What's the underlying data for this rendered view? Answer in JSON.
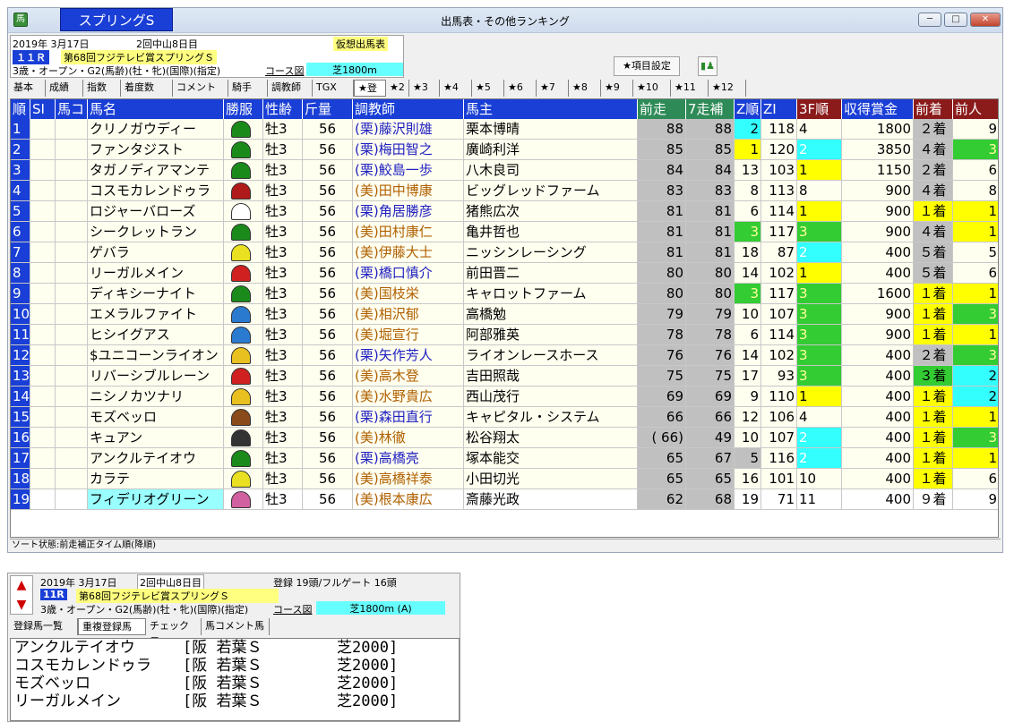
{
  "window": {
    "title": "出馬表・その他ランキング",
    "race_tab": "スプリングS",
    "controls": {
      "minimize": "─",
      "maximize": "□",
      "close": "✕"
    }
  },
  "race": {
    "date": "2019年 3月17日",
    "meeting": "2回中山8日目",
    "mode": "仮想出馬表",
    "race_no": "１１Ｒ",
    "race_name": "第68回フジテレビ賞スプリングＳ",
    "conditions": "3歳・オープン・G2(馬齢)(牡・牝)(国際)(指定)",
    "course_label": "コース図",
    "surface": "芝1800m"
  },
  "toolbar": {
    "item_settings": "★項目設定"
  },
  "tabs": [
    "基本",
    "成績",
    "指数",
    "着度数",
    "コメント",
    "騎手",
    "調教師",
    "TGX",
    "★登録",
    "★2",
    "★3",
    "★4",
    "★5",
    "★6",
    "★7",
    "★8",
    "★9",
    "★10",
    "★11",
    "★12"
  ],
  "active_tab": "★登録",
  "columns": [
    "順",
    "SI",
    "馬コ",
    "馬名",
    "勝服",
    "性齢",
    "斤量",
    "調教師",
    "馬主",
    "前走",
    "7走補",
    "Z順",
    "ZI",
    "3F順",
    "収得賞金",
    "前着",
    "前人"
  ],
  "colors": {
    "header_blue": "#1a3fd6",
    "header_green": "#2e8b57",
    "header_darkred": "#8b1a1a",
    "yellow": "#ffff00",
    "cyan": "#33ffff",
    "green": "#33cc33",
    "gray": "#c0c0c0",
    "miho": "#b06000",
    "ritto": "#2020c0"
  },
  "rows": [
    {
      "no": "1",
      "name": "クリノガウディー",
      "sex": "牡3",
      "wt": "56",
      "trainer": "(栗)藤沢則雄",
      "tloc": "栗",
      "owner": "栗本博晴",
      "prev": "88",
      "seven": "88",
      "zr": "2",
      "zrc": "cyan",
      "zi": "118",
      "f3": "4",
      "f3c": "",
      "prize": "1800",
      "pc": "２着",
      "pcc": "gray",
      "pp": "9",
      "ppc": ""
    },
    {
      "no": "2",
      "name": "ファンタジスト",
      "sex": "牡3",
      "wt": "56",
      "trainer": "(栗)梅田智之",
      "tloc": "栗",
      "owner": "廣崎利洋",
      "prev": "85",
      "seven": "85",
      "zr": "1",
      "zrc": "yellow",
      "zi": "120",
      "f3": "2",
      "f3c": "cyan",
      "prize": "3850",
      "pc": "４着",
      "pcc": "gray",
      "pp": "3",
      "ppc": "green"
    },
    {
      "no": "3",
      "name": "タガノディアマンテ",
      "sex": "牡3",
      "wt": "56",
      "trainer": "(栗)鮫島一歩",
      "tloc": "栗",
      "owner": "八木良司",
      "prev": "84",
      "seven": "84",
      "zr": "13",
      "zrc": "",
      "zi": "103",
      "f3": "1",
      "f3c": "yellow",
      "prize": "1150",
      "pc": "２着",
      "pcc": "gray",
      "pp": "6",
      "ppc": ""
    },
    {
      "no": "4",
      "name": "コスモカレンドゥラ",
      "sex": "牡3",
      "wt": "56",
      "trainer": "(美)田中博康",
      "tloc": "美",
      "owner": "ビッグレッドファーム",
      "prev": "83",
      "seven": "83",
      "zr": "8",
      "zrc": "",
      "zi": "113",
      "f3": "8",
      "f3c": "",
      "prize": "900",
      "pc": "４着",
      "pcc": "gray",
      "pp": "8",
      "ppc": ""
    },
    {
      "no": "5",
      "name": "ロジャーバローズ",
      "sex": "牡3",
      "wt": "56",
      "trainer": "(栗)角居勝彦",
      "tloc": "栗",
      "owner": "猪熊広次",
      "prev": "81",
      "seven": "81",
      "zr": "6",
      "zrc": "",
      "zi": "114",
      "f3": "1",
      "f3c": "yellow",
      "prize": "900",
      "pc": "１着",
      "pcc": "yellow",
      "pp": "1",
      "ppc": "yellow"
    },
    {
      "no": "6",
      "name": "シークレットラン",
      "sex": "牡3",
      "wt": "56",
      "trainer": "(美)田村康仁",
      "tloc": "美",
      "owner": "亀井哲也",
      "prev": "81",
      "seven": "81",
      "zr": "3",
      "zrc": "green",
      "zi": "117",
      "f3": "3",
      "f3c": "green",
      "prize": "900",
      "pc": "４着",
      "pcc": "gray",
      "pp": "1",
      "ppc": "yellow"
    },
    {
      "no": "7",
      "name": "ゲバラ",
      "sex": "牡3",
      "wt": "56",
      "trainer": "(美)伊藤大士",
      "tloc": "美",
      "owner": "ニッシンレーシング",
      "prev": "81",
      "seven": "81",
      "zr": "18",
      "zrc": "",
      "zi": "87",
      "f3": "2",
      "f3c": "cyan",
      "prize": "400",
      "pc": "５着",
      "pcc": "gray",
      "pp": "5",
      "ppc": ""
    },
    {
      "no": "8",
      "name": "リーガルメイン",
      "sex": "牡3",
      "wt": "56",
      "trainer": "(栗)橋口慎介",
      "tloc": "栗",
      "owner": "前田晋二",
      "prev": "80",
      "seven": "80",
      "zr": "14",
      "zrc": "",
      "zi": "102",
      "f3": "1",
      "f3c": "yellow",
      "prize": "400",
      "pc": "５着",
      "pcc": "gray",
      "pp": "6",
      "ppc": ""
    },
    {
      "no": "9",
      "name": "ディキシーナイト",
      "sex": "牡3",
      "wt": "56",
      "trainer": "(美)国枝栄",
      "tloc": "美",
      "owner": "キャロットファーム",
      "prev": "80",
      "seven": "80",
      "zr": "3",
      "zrc": "green",
      "zi": "117",
      "f3": "3",
      "f3c": "green",
      "prize": "1600",
      "pc": "１着",
      "pcc": "yellow",
      "pp": "1",
      "ppc": "yellow"
    },
    {
      "no": "10",
      "name": "エメラルファイト",
      "sex": "牡3",
      "wt": "56",
      "trainer": "(美)相沢郁",
      "tloc": "美",
      "owner": "高橋勉",
      "prev": "79",
      "seven": "79",
      "zr": "10",
      "zrc": "",
      "zi": "107",
      "f3": "3",
      "f3c": "green",
      "prize": "900",
      "pc": "１着",
      "pcc": "yellow",
      "pp": "3",
      "ppc": "green"
    },
    {
      "no": "11",
      "name": "ヒシイグアス",
      "sex": "牡3",
      "wt": "56",
      "trainer": "(美)堀宣行",
      "tloc": "美",
      "owner": "阿部雅英",
      "prev": "78",
      "seven": "78",
      "zr": "6",
      "zrc": "",
      "zi": "114",
      "f3": "3",
      "f3c": "green",
      "prize": "900",
      "pc": "１着",
      "pcc": "yellow",
      "pp": "1",
      "ppc": "yellow"
    },
    {
      "no": "12",
      "name": "$ユニコーンライオン",
      "sex": "牡3",
      "wt": "56",
      "trainer": "(栗)矢作芳人",
      "tloc": "栗",
      "owner": "ライオンレースホース",
      "prev": "76",
      "seven": "76",
      "zr": "14",
      "zrc": "",
      "zi": "102",
      "f3": "3",
      "f3c": "green",
      "prize": "400",
      "pc": "２着",
      "pcc": "gray",
      "pp": "3",
      "ppc": "green"
    },
    {
      "no": "13",
      "name": "リバーシブルレーン",
      "sex": "牡3",
      "wt": "56",
      "trainer": "(美)高木登",
      "tloc": "美",
      "owner": "吉田照哉",
      "prev": "75",
      "seven": "75",
      "zr": "17",
      "zrc": "",
      "zi": "93",
      "f3": "3",
      "f3c": "green",
      "prize": "400",
      "pc": "３着",
      "pcc": "green",
      "pp": "2",
      "ppc": "cyan"
    },
    {
      "no": "14",
      "name": "ニシノカツナリ",
      "sex": "牡3",
      "wt": "56",
      "trainer": "(美)水野貴広",
      "tloc": "美",
      "owner": "西山茂行",
      "prev": "69",
      "seven": "69",
      "zr": "9",
      "zrc": "",
      "zi": "110",
      "f3": "1",
      "f3c": "yellow",
      "prize": "400",
      "pc": "１着",
      "pcc": "yellow",
      "pp": "2",
      "ppc": "cyan"
    },
    {
      "no": "15",
      "name": "モズベッロ",
      "sex": "牡3",
      "wt": "56",
      "trainer": "(栗)森田直行",
      "tloc": "栗",
      "owner": "キャピタル・システム",
      "prev": "66",
      "seven": "66",
      "zr": "12",
      "zrc": "",
      "zi": "106",
      "f3": "4",
      "f3c": "",
      "prize": "400",
      "pc": "１着",
      "pcc": "yellow",
      "pp": "1",
      "ppc": "yellow"
    },
    {
      "no": "16",
      "name": "キュアン",
      "sex": "牡3",
      "wt": "56",
      "trainer": "(美)林徹",
      "tloc": "美",
      "owner": "松谷翔太",
      "prev": "( 66)",
      "seven": "49",
      "zr": "10",
      "zrc": "",
      "zi": "107",
      "f3": "2",
      "f3c": "cyan",
      "prize": "400",
      "pc": "１着",
      "pcc": "yellow",
      "pp": "3",
      "ppc": "green"
    },
    {
      "no": "17",
      "name": "アンクルテイオウ",
      "sex": "牡3",
      "wt": "56",
      "trainer": "(栗)高橋亮",
      "tloc": "栗",
      "owner": "塚本能交",
      "prev": "65",
      "seven": "67",
      "zr": "5",
      "zrc": "gray",
      "zi": "116",
      "f3": "2",
      "f3c": "cyan",
      "prize": "400",
      "pc": "１着",
      "pcc": "yellow",
      "pp": "1",
      "ppc": "yellow"
    },
    {
      "no": "18",
      "name": "カラテ",
      "sex": "牡3",
      "wt": "56",
      "trainer": "(美)高橋祥泰",
      "tloc": "美",
      "owner": "小田切光",
      "prev": "65",
      "seven": "65",
      "zr": "16",
      "zrc": "",
      "zi": "101",
      "f3": "10",
      "f3c": "",
      "prize": "400",
      "pc": "１着",
      "pcc": "yellow",
      "pp": "6",
      "ppc": ""
    },
    {
      "no": "19",
      "name": "フィデリオグリーン",
      "sex": "牡3",
      "wt": "56",
      "trainer": "(美)根本康広",
      "tloc": "美",
      "owner": "斎藤光政",
      "prev": "62",
      "seven": "68",
      "zr": "19",
      "zrc": "",
      "zi": "71",
      "f3": "11",
      "f3c": "",
      "prize": "400",
      "pc": "９着",
      "pcc": "",
      "pp": "9",
      "ppc": ""
    }
  ],
  "status": "ソート状態:前走補正タイム順(降順)",
  "panel2": {
    "date": "2019年 3月17日",
    "meeting": "2回中山8日目",
    "registration": "登録 19頭/フルゲート 16頭",
    "race_no": "11R",
    "race_name": "第68回フジテレビ賞スプリングＳ",
    "conditions": "3歳・オープン・G2(馬齢)(牡・牝)(国際)(指定)",
    "course_label": "コース図",
    "surface": "芝1800m (A)",
    "tabs": [
      "登録馬一覧",
      "重複登録馬",
      "チェック馬",
      "馬コメント馬"
    ],
    "list": [
      {
        "horse": "アンクルテイオウ",
        "race": "[阪 若葉Ｓ",
        "dist": "芝2000]"
      },
      {
        "horse": "コスモカレンドゥラ",
        "race": "[阪 若葉Ｓ",
        "dist": "芝2000]"
      },
      {
        "horse": "モズベッロ",
        "race": "[阪 若葉Ｓ",
        "dist": "芝2000]"
      },
      {
        "horse": "リーガルメイン",
        "race": "[阪 若葉Ｓ",
        "dist": "芝2000]"
      }
    ]
  }
}
